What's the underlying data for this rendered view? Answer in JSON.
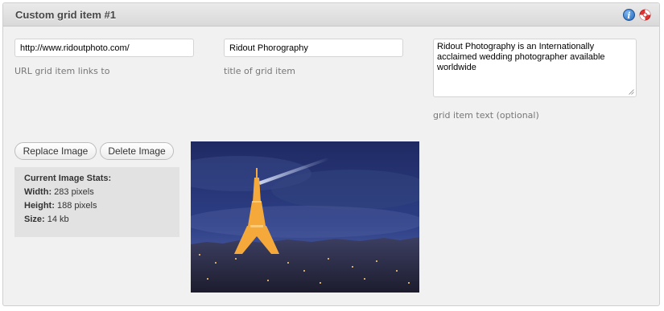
{
  "panel": {
    "title": "Custom grid item #1"
  },
  "icons": {
    "help": "info-icon",
    "support": "lifebuoy-icon",
    "help_glyph": "i"
  },
  "url_field": {
    "value": "http://www.ridoutphoto.com/",
    "hint": "URL grid item links to"
  },
  "title_field": {
    "value": "Ridout Phorography",
    "hint": "title of grid item"
  },
  "text_field": {
    "value": "Ridout Photography is an Internationally acclaimed wedding photographer available worldwide",
    "hint": "grid item text (optional)"
  },
  "buttons": {
    "replace": "Replace Image",
    "delete": "Delete Image"
  },
  "stats": {
    "heading": "Current Image Stats:",
    "width_label": "Width:",
    "width_value": "283 pixels",
    "height_label": "Height:",
    "height_value": "188 pixels",
    "size_label": "Size:",
    "size_value": "14 kb"
  },
  "image": {
    "subject": "eiffel-tower-night-photo"
  },
  "colors": {
    "panel_bg": "#f1f1f1",
    "header_bg": "#dedede",
    "stats_bg": "#e2e2e2",
    "hint_text": "#777777"
  }
}
